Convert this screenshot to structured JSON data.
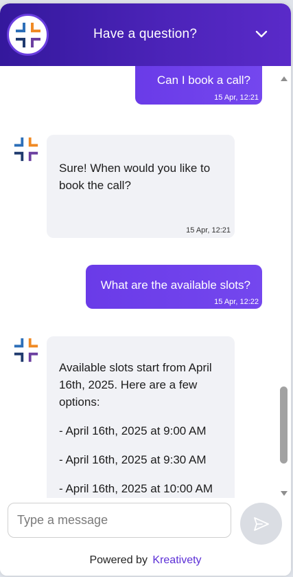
{
  "header": {
    "title": "Have a question?",
    "collapse_icon": "chevron-down-icon"
  },
  "messages": [
    {
      "role": "user",
      "text": "Can I book a call?",
      "time": "15 Apr, 12:21"
    },
    {
      "role": "bot",
      "lines": [
        "Sure! When would you like to",
        "book the call?"
      ],
      "time": "15 Apr, 12:21"
    },
    {
      "role": "user",
      "text": "What are the available slots?",
      "time": "15 Apr, 12:22"
    },
    {
      "role": "bot",
      "lines": [
        "Available slots start from April",
        "16th, 2025. Here are a few",
        "options:",
        "- April 16th, 2025 at 9:00 AM",
        "- April 16th, 2025 at 9:30 AM",
        "- April 16th, 2025 at 10:00 AM"
      ]
    }
  ],
  "composer": {
    "placeholder": "Type a message",
    "send_icon": "send-icon"
  },
  "footer": {
    "powered_label": "Powered by",
    "brand": "Kreativety"
  },
  "colors": {
    "header_gradient_start": "#34189c",
    "header_gradient_end": "#5a2ac9",
    "user_bubble": "#6a3be8",
    "bot_bubble": "#f1f2f6",
    "logo_blue": "#2d6fb8",
    "logo_orange": "#f08a24",
    "logo_navy": "#1f3a6e",
    "logo_purple": "#6b3fa0"
  }
}
